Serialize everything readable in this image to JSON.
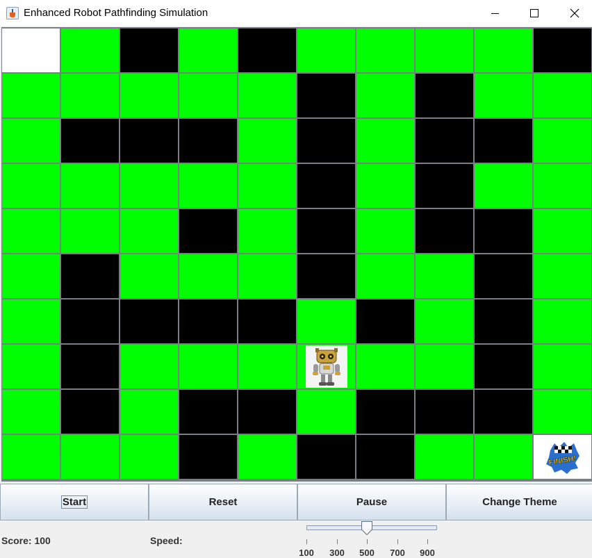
{
  "window": {
    "title": "Enhanced Robot Pathfinding Simulation",
    "controls": [
      "minimize-icon",
      "maximize-icon",
      "close-icon"
    ]
  },
  "grid": {
    "rows": 10,
    "cols": 10,
    "legend": {
      "G": "open",
      "B": "wall",
      "W": "start",
      "R": "robot",
      "F": "finish"
    },
    "colors": {
      "open": "#00ff00",
      "wall": "#000000",
      "start": "#ffffff",
      "lines": "#7a7f86"
    },
    "cells": [
      [
        "W",
        "G",
        "B",
        "G",
        "B",
        "G",
        "G",
        "G",
        "G",
        "B"
      ],
      [
        "G",
        "G",
        "G",
        "G",
        "G",
        "B",
        "G",
        "B",
        "G",
        "G"
      ],
      [
        "G",
        "B",
        "B",
        "B",
        "G",
        "B",
        "G",
        "B",
        "B",
        "G"
      ],
      [
        "G",
        "G",
        "G",
        "G",
        "G",
        "B",
        "G",
        "B",
        "G",
        "G"
      ],
      [
        "G",
        "G",
        "G",
        "B",
        "G",
        "B",
        "G",
        "B",
        "B",
        "G"
      ],
      [
        "G",
        "B",
        "G",
        "G",
        "G",
        "B",
        "G",
        "G",
        "B",
        "G"
      ],
      [
        "G",
        "B",
        "B",
        "B",
        "B",
        "G",
        "B",
        "G",
        "B",
        "G"
      ],
      [
        "G",
        "B",
        "G",
        "G",
        "G",
        "R",
        "G",
        "G",
        "B",
        "G"
      ],
      [
        "G",
        "B",
        "G",
        "B",
        "B",
        "G",
        "B",
        "B",
        "B",
        "G"
      ],
      [
        "G",
        "G",
        "G",
        "B",
        "G",
        "B",
        "B",
        "G",
        "G",
        "F"
      ]
    ],
    "robot_icon": "robot-icon",
    "finish_icon": "finish-flag-icon",
    "finish_text": "FINISH!"
  },
  "controls": {
    "start_label": "Start",
    "reset_label": "Reset",
    "pause_label": "Pause",
    "theme_label": "Change Theme"
  },
  "status": {
    "score_label": "Score: 100",
    "speed_label": "Speed:"
  },
  "speed_slider": {
    "min": 100,
    "max": 900,
    "value": 500,
    "tick_labels": [
      "100",
      "300",
      "500",
      "700",
      "900"
    ]
  }
}
